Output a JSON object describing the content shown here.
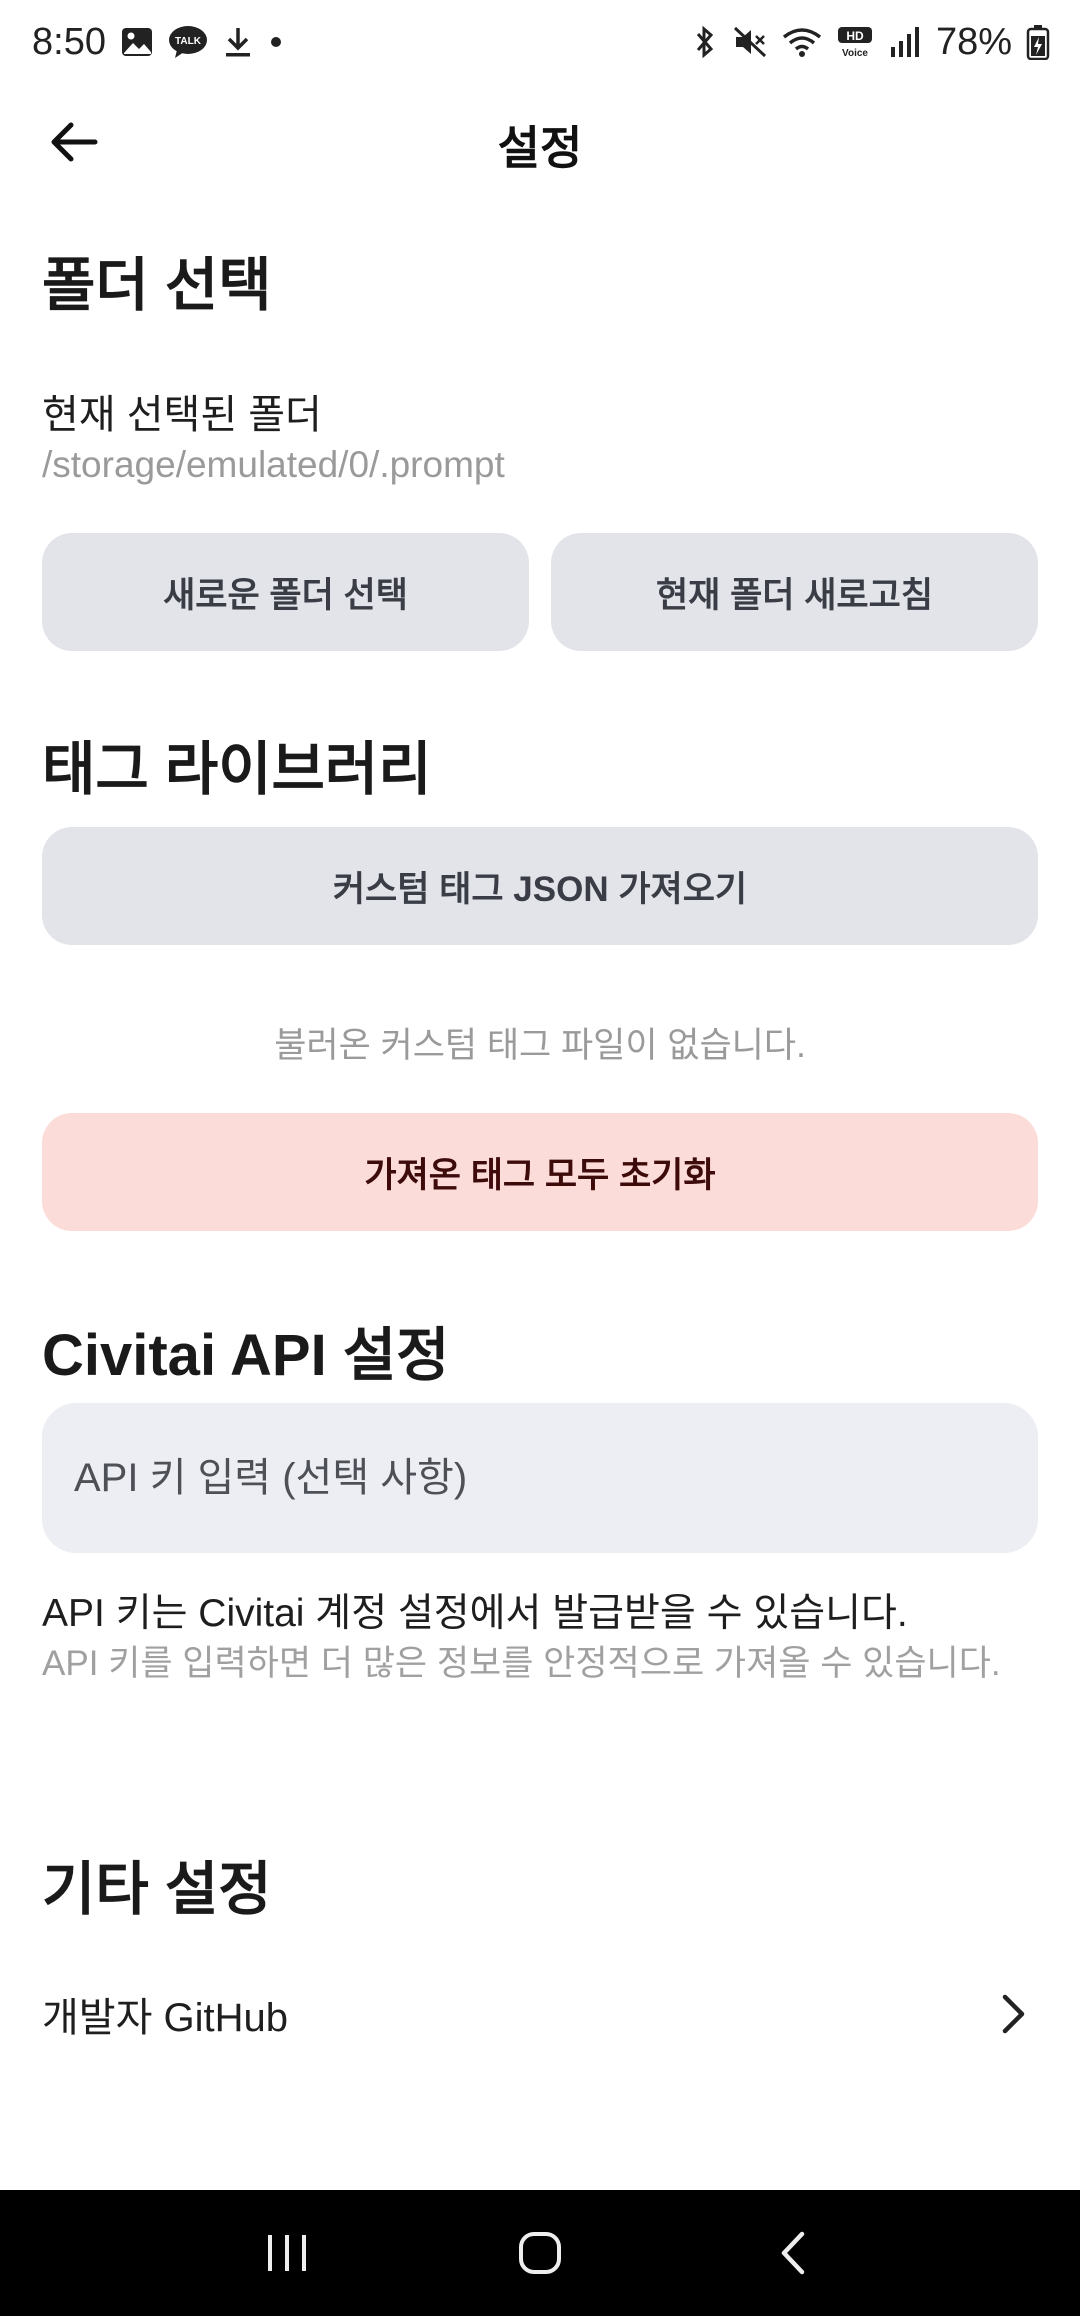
{
  "status_bar": {
    "time": "8:50",
    "battery": "78%",
    "icons_left": [
      "gallery-icon",
      "kakaotalk-icon",
      "download-icon",
      "dot-icon"
    ],
    "icons_right": [
      "bluetooth-icon",
      "mute-icon",
      "wifi-icon",
      "hd-voice-icon",
      "signal-icon",
      "battery-icon"
    ]
  },
  "app_bar": {
    "title": "설정",
    "back_icon": "arrow-left-icon"
  },
  "folder_section": {
    "title": "폴더 선택",
    "current_label": "현재 선택된 폴더",
    "current_path": "/storage/emulated/0/.prompt",
    "select_button": "새로운 폴더 선택",
    "refresh_button": "현재 폴더 새로고침"
  },
  "tag_section": {
    "title": "태그 라이브러리",
    "import_button": "커스텀 태그 JSON 가져오기",
    "empty_note": "불러온 커스텀 태그 파일이 없습니다.",
    "reset_button": "가져온 태그 모두 초기화"
  },
  "civitai_section": {
    "title": "Civitai API 설정",
    "api_placeholder": "API 키 입력 (선택 사항)",
    "api_value": "",
    "help_text": "API 키는 Civitai 계정 설정에서 발급받을 수 있습니다.",
    "sub_text": "API 키를 입력하면 더 많은 정보를 안정적으로 가져올 수 있습니다."
  },
  "other_section": {
    "title": "기타 설정",
    "github_label": "개발자 GitHub",
    "github_icon": "chevron-right-icon"
  },
  "nav_bar": {
    "icons": [
      "recent-apps-icon",
      "home-icon",
      "back-icon"
    ]
  },
  "colors": {
    "button_bg": "#e2e4ea",
    "danger_bg": "#fcdcd8",
    "input_bg": "#edeef3",
    "muted_text": "#9a9a9a"
  }
}
